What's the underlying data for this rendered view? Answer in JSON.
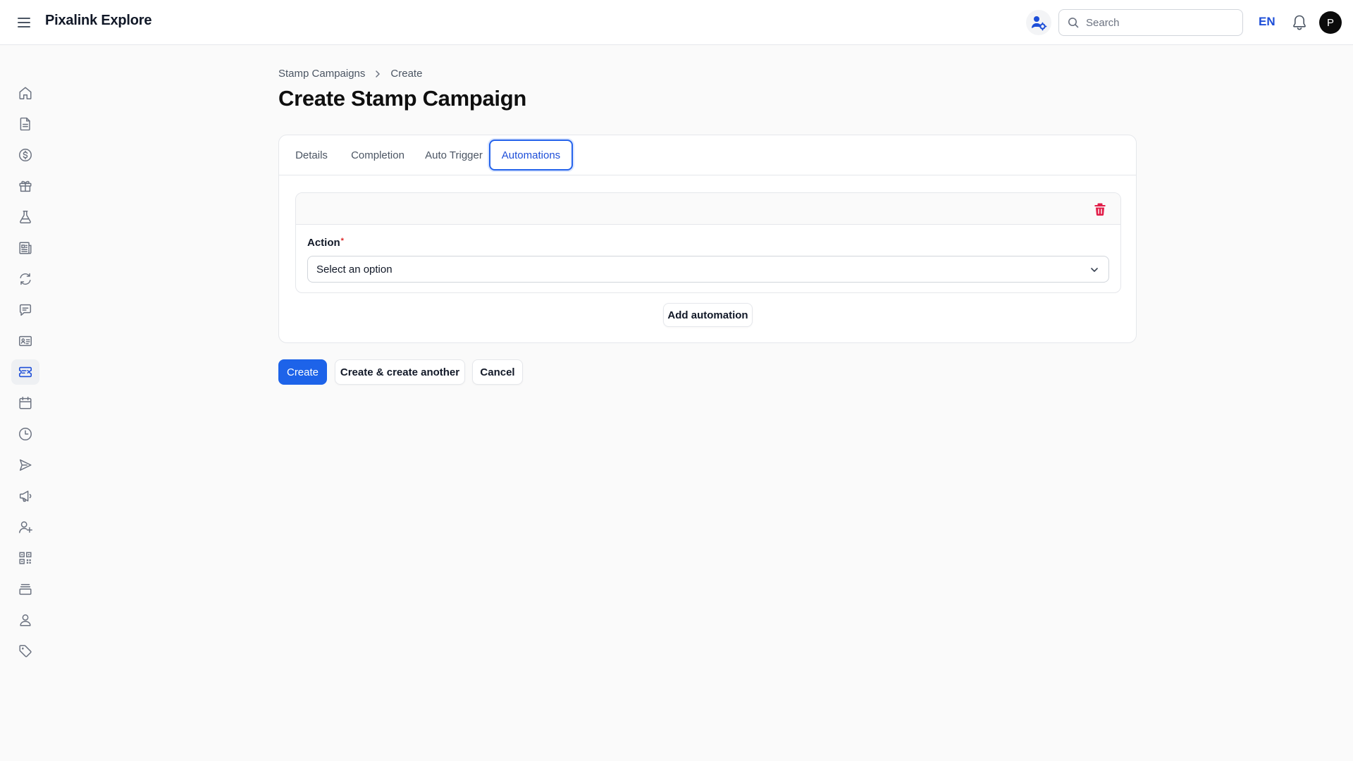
{
  "app": {
    "name": "Pixalink Explore"
  },
  "header": {
    "search_placeholder": "Search",
    "language": "EN",
    "avatar_initial": "P",
    "accent_color": "#1d4ed8"
  },
  "sidebar": {
    "items": [
      {
        "icon": "home-icon"
      },
      {
        "icon": "document-icon"
      },
      {
        "icon": "dollar-icon"
      },
      {
        "icon": "gift-icon"
      },
      {
        "icon": "flask-icon"
      },
      {
        "icon": "newspaper-icon"
      },
      {
        "icon": "refresh-icon"
      },
      {
        "icon": "chat-icon"
      },
      {
        "icon": "id-card-icon"
      },
      {
        "icon": "ticket-icon",
        "active": true
      },
      {
        "icon": "calendar-icon"
      },
      {
        "icon": "clock-icon"
      },
      {
        "icon": "send-icon"
      },
      {
        "icon": "megaphone-icon"
      },
      {
        "icon": "user-plus-icon"
      },
      {
        "icon": "qr-code-icon"
      },
      {
        "icon": "layers-icon"
      },
      {
        "icon": "user-icon"
      },
      {
        "icon": "tag-icon"
      }
    ]
  },
  "breadcrumb": {
    "parent": "Stamp Campaigns",
    "current": "Create"
  },
  "page": {
    "title": "Create Stamp Campaign"
  },
  "tabs": [
    {
      "label": "Details"
    },
    {
      "label": "Completion"
    },
    {
      "label": "Auto Trigger"
    },
    {
      "label": "Automations",
      "active": true
    }
  ],
  "automation": {
    "action_label": "Action",
    "required_marker": "*",
    "action_placeholder": "Select an option",
    "add_label": "Add automation"
  },
  "actions": {
    "create": "Create",
    "create_another": "Create & create another",
    "cancel": "Cancel"
  }
}
